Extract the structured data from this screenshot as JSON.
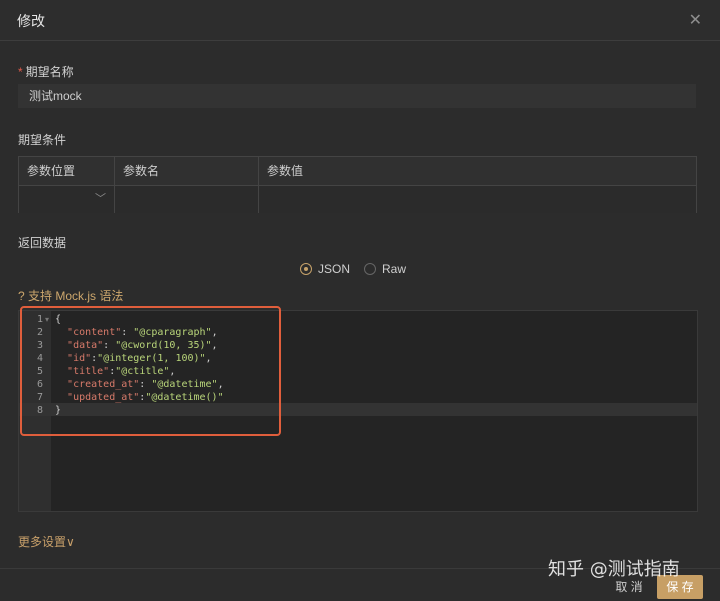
{
  "window": {
    "title": "修改"
  },
  "form": {
    "name": {
      "required_mark": "*",
      "label": "期望名称",
      "value": "测试mock"
    },
    "conditions": {
      "label": "期望条件",
      "columns": [
        "参数位置",
        "参数名",
        "参数值"
      ],
      "row": {
        "position": "",
        "name": "",
        "value": ""
      }
    },
    "response": {
      "label": "返回数据",
      "options": [
        {
          "label": "JSON",
          "selected": true
        },
        {
          "label": "Raw",
          "selected": false
        }
      ],
      "hint": "? 支持 Mock.js 语法"
    },
    "more_label": "更多设置",
    "more_icon": "chevron-down-icon"
  },
  "editor": {
    "lines": [
      {
        "n": "1",
        "text": "{"
      },
      {
        "n": "2",
        "key": "\"content\"",
        "sep": ": ",
        "value": "\"@cparagraph\"",
        "end": ","
      },
      {
        "n": "3",
        "key": "\"data\"",
        "sep": ": ",
        "value": "\"@cword(10, 35)\"",
        "end": ","
      },
      {
        "n": "4",
        "key": "\"id\"",
        "sep": ":",
        "value": "\"@integer(1, 100)\"",
        "end": ","
      },
      {
        "n": "5",
        "key": "\"title\"",
        "sep": ":",
        "value": "\"@ctitle\"",
        "end": ","
      },
      {
        "n": "6",
        "key": "\"created_at\"",
        "sep": ": ",
        "value": "\"@datetime\"",
        "end": ","
      },
      {
        "n": "7",
        "key": "\"updated_at\"",
        "sep": ":",
        "value": "\"@datetime()\"",
        "end": ""
      },
      {
        "n": "8",
        "text": "}"
      }
    ]
  },
  "footer": {
    "cancel": "取 消",
    "save": "保 存"
  },
  "watermark": "知乎 @测试指南",
  "colors": {
    "accent": "#c79f65",
    "highlight_box": "#e05e3c",
    "key": "#d77a6a",
    "string": "#b9d57a"
  }
}
